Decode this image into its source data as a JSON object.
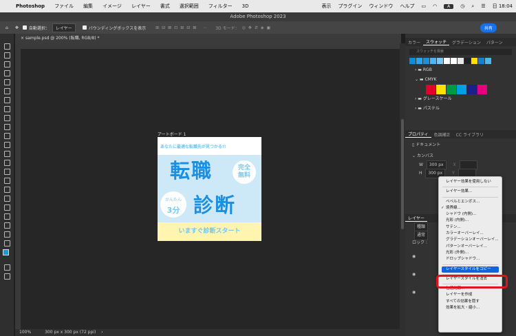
{
  "menubar": {
    "app": "Photoshop",
    "items": [
      "ファイル",
      "編集",
      "イメージ",
      "レイヤー",
      "書式",
      "選択範囲",
      "フィルター",
      "3D",
      "表示",
      "プラグイン",
      "ウィンドウ",
      "ヘルプ"
    ],
    "kbd": "A",
    "clock": "日 18:04"
  },
  "window_title": "Adobe Photoshop 2023",
  "options_bar": {
    "auto_select": "自動選択：",
    "auto_select_target": "レイヤー",
    "bounding_box": "バウンディングボックスを表示",
    "mode_3d": "3D モード：",
    "share": "共有"
  },
  "document_tab": "sample.psd @ 200% (転職, RGB/8) *",
  "status": {
    "zoom": "100%",
    "doc_info": "300 px x 300 px (72 ppi)"
  },
  "artboard": {
    "label": "アートボード 1",
    "tagline": "あなたに最適な転職先が見つかる!!",
    "big1": "転職",
    "big2": "診断",
    "badge1": "完全\n無料",
    "badge2_small": "かんたん",
    "badge2_big": "3分",
    "cta": "いますぐ診断スタート"
  },
  "swatches_panel": {
    "tabs": [
      "カラー",
      "スウォッチ",
      "グラデーション",
      "パターン"
    ],
    "active_tab": "スウォッチ",
    "search_placeholder": "スウォッチを検索",
    "recent_colors": [
      "#0a8fd6",
      "#2aa6e8",
      "#1f8fd8",
      "#50b5ee",
      "#7bc7f1",
      "#ffffff",
      "#ffffff",
      "#e8e8e8",
      "#222222",
      "#ffe100",
      "#1680cf",
      "#4bb8ec"
    ],
    "groups": [
      "RGB",
      "CMYK",
      "グレースケール",
      "パステル"
    ],
    "cmyk_colors": [
      "#e4002b",
      "#ffe100",
      "#009944",
      "#00a0e9",
      "#1d2088",
      "#e4007f"
    ]
  },
  "properties_panel": {
    "tabs": [
      "プロパティ",
      "色調補正",
      "CC ライブラリ"
    ],
    "active_tab": "プロパティ",
    "doc_label": "ドキュメント",
    "canvas_label": "カンバス",
    "w_label": "W",
    "w_value": "300 px",
    "h_label": "H",
    "h_value": "300 px",
    "x_label": "X",
    "y_label": "Y"
  },
  "layers_panel": {
    "title": "レイヤー",
    "kind_label": "種類",
    "mode_label": "通常",
    "lock_label": "ロック :"
  },
  "context_menu": {
    "items": [
      {
        "label": "レイヤー効果を使用しない"
      },
      {
        "sep": true
      },
      {
        "label": "レイヤー効果..."
      },
      {
        "sep": true
      },
      {
        "label": "ベベルとエンボス..."
      },
      {
        "label": "境界線...",
        "checked": true
      },
      {
        "label": "シャドウ (内側)..."
      },
      {
        "label": "光彩 (内側)..."
      },
      {
        "label": "サテン..."
      },
      {
        "label": "カラーオーバーレイ..."
      },
      {
        "label": "グラデーションオーバーレイ..."
      },
      {
        "label": "パターンオーバーレイ..."
      },
      {
        "label": "光彩 (外側)..."
      },
      {
        "label": "ドロップシャドウ..."
      },
      {
        "sep": true
      },
      {
        "label": "レイヤースタイルをコピー",
        "highlighted": true
      },
      {
        "sep": true
      },
      {
        "label": "レイヤースタイルを消去"
      },
      {
        "sep": true
      },
      {
        "label": "包括光源..."
      },
      {
        "label": "レイヤーを作成"
      },
      {
        "label": "すべての効果を隠す"
      },
      {
        "label": "効果を拡大・縮小..."
      }
    ]
  },
  "colors": {
    "highlight": "#1463d8",
    "annotation_red": "#e0141c",
    "accent_blue": "#1473e6"
  }
}
